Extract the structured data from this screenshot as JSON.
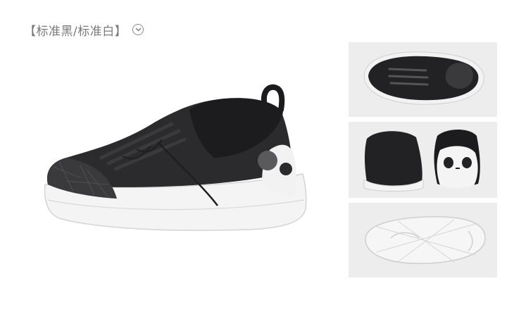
{
  "header": {
    "variant_label": "【标准黑/标准白】",
    "dropdown_icon": "chevron-down-icon"
  },
  "main_image": {
    "subject": "shoe-side-view"
  },
  "thumbnails": [
    {
      "subject": "shoe-top-view"
    },
    {
      "subject": "shoe-heel-view"
    },
    {
      "subject": "shoe-sole-view"
    }
  ],
  "colors": {
    "label_text": "#7a7a7a",
    "thumb_bg": "#ededed",
    "shoe_upper": "#2b2b2d",
    "shoe_sole": "#f4f4f4"
  }
}
